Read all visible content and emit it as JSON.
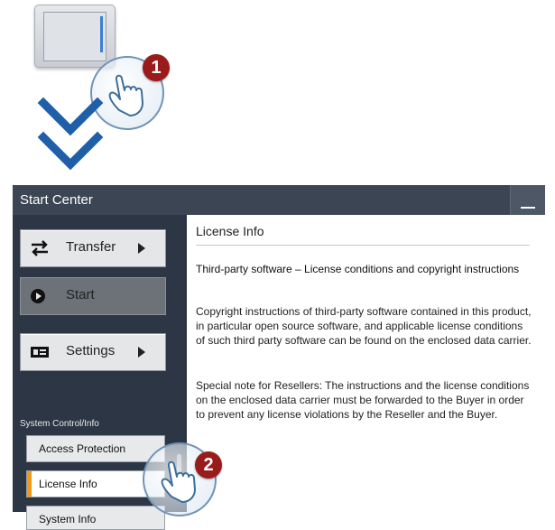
{
  "illustration": {
    "step1": "1",
    "step2": "2"
  },
  "window": {
    "title": "Start Center"
  },
  "sidebar": {
    "transfer_label": "Transfer",
    "start_label": "Start",
    "settings_label": "Settings",
    "section_label": "System Control/Info",
    "items": [
      {
        "label": "Access Protection"
      },
      {
        "label": "License Info"
      },
      {
        "label": "System Info"
      }
    ]
  },
  "content": {
    "heading": "License Info",
    "subtitle": "Third-party software – License conditions and copyright instructions",
    "paragraph1": "Copyright instructions of third-party software contained  in this product, in particular open source software, and applicable license conditions of such third party software can be found on the enclosed data carrier.",
    "paragraph2": "Special note for Resellers: The instructions and the license conditions on the enclosed data carrier must be forwarded to the Buyer in order to prevent any license violations by the Reseller and the Buyer."
  },
  "colors": {
    "accent_arrow": "#1f5faa",
    "badge": "#9a1b1b",
    "active_marker": "#f39a1b"
  }
}
